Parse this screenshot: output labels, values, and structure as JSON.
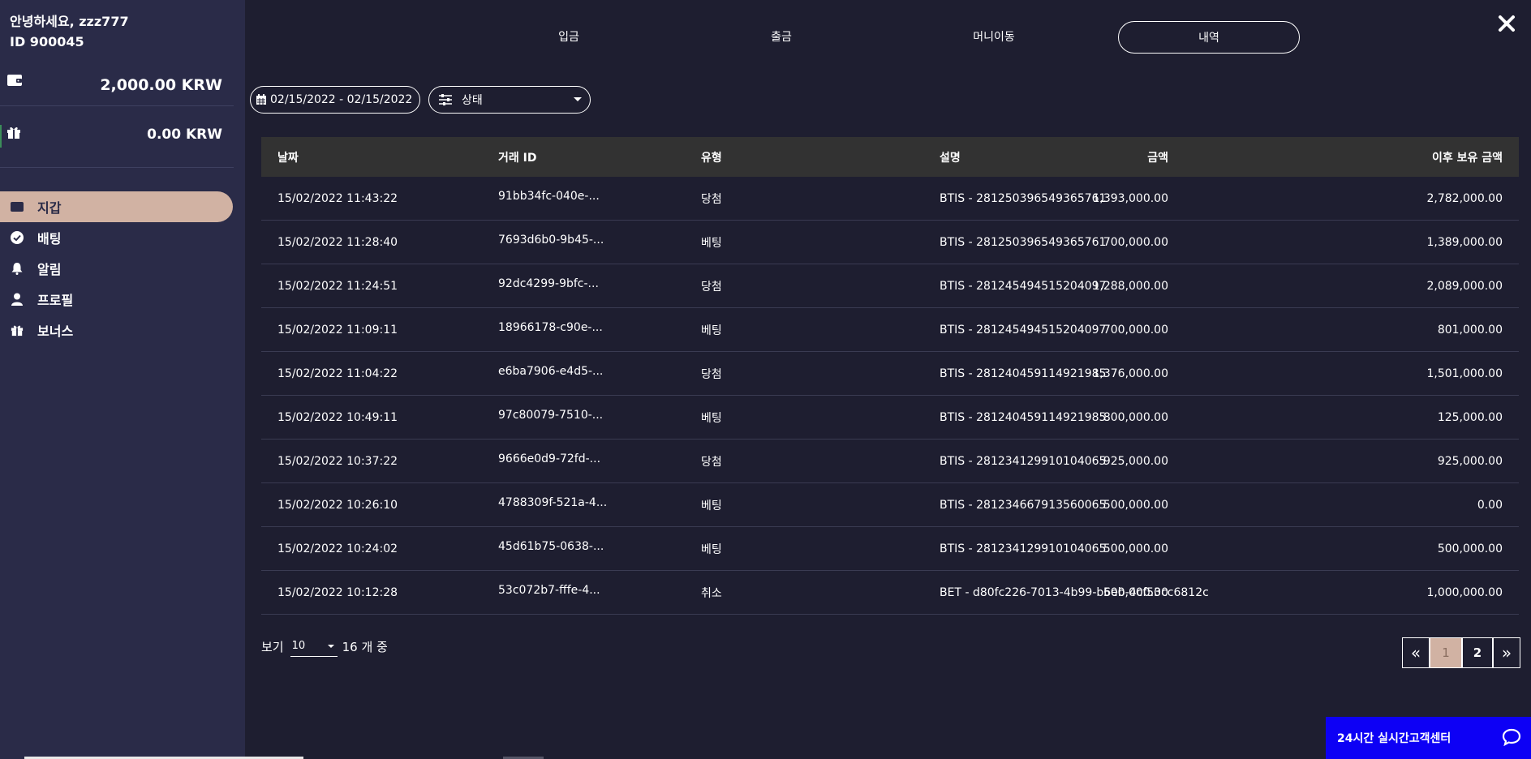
{
  "user": {
    "greeting": "안녕하세요, zzz777",
    "id_label": "ID 900045"
  },
  "balances": {
    "wallet_amount": "2,000.00 KRW",
    "bonus_amount": "0.00 KRW"
  },
  "menu": [
    {
      "label": "지갑",
      "icon": "wallet-icon",
      "active": true
    },
    {
      "label": "배팅",
      "icon": "check-circle-icon"
    },
    {
      "label": "알림",
      "icon": "bell-icon"
    },
    {
      "label": "프로필",
      "icon": "user-icon"
    },
    {
      "label": "보너스",
      "icon": "gift-icon"
    }
  ],
  "tabs": [
    "입금",
    "출금",
    "머니이동",
    "내역"
  ],
  "filters": {
    "date_range": "02/15/2022 - 02/15/2022",
    "status_label": "상태"
  },
  "table": {
    "headers": [
      "날짜",
      "거래 ID",
      "유형",
      "금액",
      "설명",
      "이후 보유 금액"
    ],
    "rows": [
      [
        "15/02/2022 11:43:22",
        "91bb34fc-040e-...",
        "당첨",
        "1,393,000.00",
        "BTIS - 281250396549365761",
        "2,782,000.00"
      ],
      [
        "15/02/2022 11:28:40",
        "7693d6b0-9b45-...",
        "베팅",
        "700,000.00",
        "BTIS - 281250396549365761",
        "1,389,000.00"
      ],
      [
        "15/02/2022 11:24:51",
        "92dc4299-9bfc-...",
        "당첨",
        "1,288,000.00",
        "BTIS - 281245494515204097",
        "2,089,000.00"
      ],
      [
        "15/02/2022 11:09:11",
        "18966178-c90e-...",
        "베팅",
        "700,000.00",
        "BTIS - 281245494515204097",
        "801,000.00"
      ],
      [
        "15/02/2022 11:04:22",
        "e6ba7906-e4d5-...",
        "당첨",
        "1,376,000.00",
        "BTIS - 281240459114921985",
        "1,501,000.00"
      ],
      [
        "15/02/2022 10:49:11",
        "97c80079-7510-...",
        "베팅",
        "800,000.00",
        "BTIS - 281240459114921985",
        "125,000.00"
      ],
      [
        "15/02/2022 10:37:22",
        "9666e0d9-72fd-...",
        "당첨",
        "925,000.00",
        "BTIS - 281234129910104065",
        "925,000.00"
      ],
      [
        "15/02/2022 10:26:10",
        "4788309f-521a-4...",
        "베팅",
        "500,000.00",
        "BTIS - 281234667913560065",
        "0.00"
      ],
      [
        "15/02/2022 10:24:02",
        "45d61b75-0638-...",
        "베팅",
        "500,000.00",
        "BTIS - 281234129910104065",
        "500,000.00"
      ],
      [
        "15/02/2022 10:12:28",
        "53c072b7-fffe-4...",
        "취소",
        "500,000.00",
        "BET - d80fc226-7013-4b99-b6eb-4cf53cc6812c",
        "1,000,000.00"
      ]
    ]
  },
  "pagination": {
    "show_label": "보기",
    "page_size": "10",
    "total_label": "16 개 중",
    "first": "«",
    "pages": [
      "1",
      "2"
    ],
    "last": "»"
  },
  "support": {
    "label": "24시간 실시간고객센터"
  },
  "colors": {
    "sidebar_bg": "#2a2b48",
    "main_bg": "#1e1e30",
    "accent": "#d1b2a3",
    "support_bg": "#0d00f5"
  }
}
